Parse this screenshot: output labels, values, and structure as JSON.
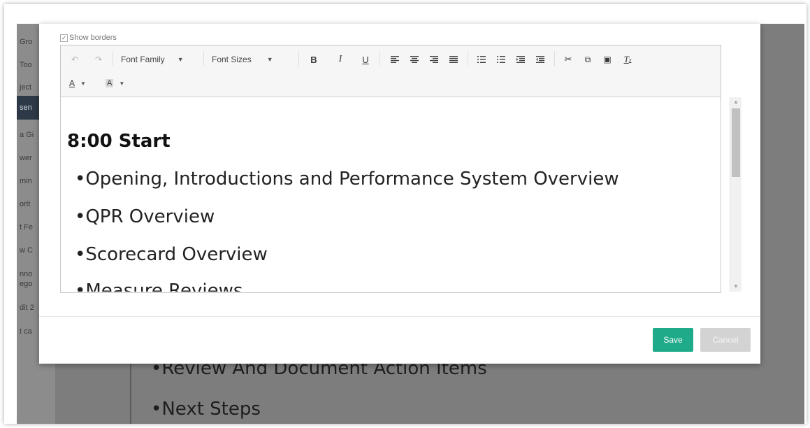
{
  "background": {
    "sidebar_items": [
      "Gro",
      "Too",
      "ject",
      "sen",
      "a Gi",
      "wer",
      "min",
      "orit",
      "t Fe",
      "w C",
      "nno",
      "ego",
      "dit 2",
      "t ca"
    ],
    "lines": [
      "•Review And Document Action Items",
      "•Next Steps"
    ]
  },
  "modal": {
    "show_borders_label": "Show borders",
    "toolbar": {
      "font_family_label": "Font Family",
      "font_sizes_label": "Font Sizes",
      "bold_label": "B",
      "italic_label": "I",
      "underline_label": "U",
      "text_color_label": "A",
      "bg_color_label": "A"
    },
    "content": {
      "heading": "8:00 Start",
      "bullets": [
        "•Opening, Introductions and Performance System Overview",
        "•QPR Overview",
        "•Scorecard Overview",
        "•Measure Reviews"
      ]
    },
    "buttons": {
      "save_label": "Save",
      "cancel_label": "Cancel"
    }
  },
  "colors": {
    "save": "#1fab89",
    "cancel": "#d3d3d3",
    "sidebar_active": "#2d3946",
    "overlay": "#7d7d7d"
  }
}
